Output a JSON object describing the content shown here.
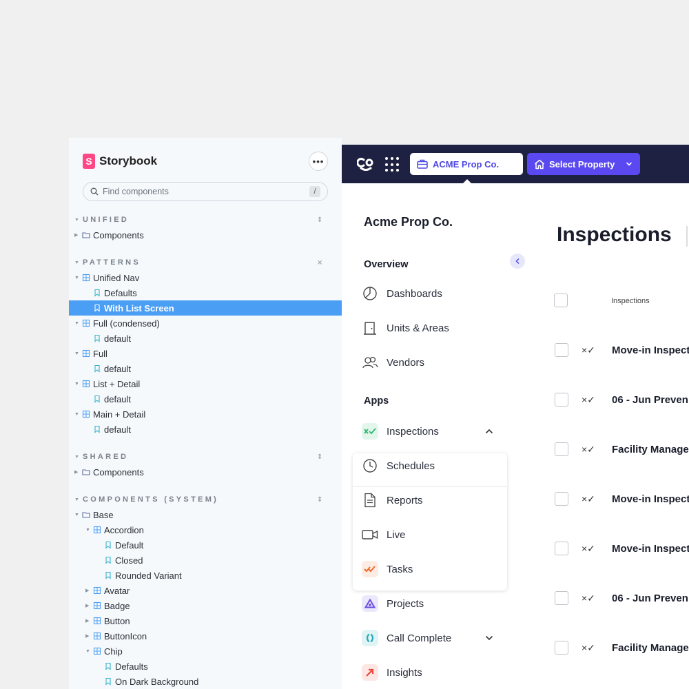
{
  "storybook": {
    "title": "Storybook",
    "logo_letter": "S",
    "search_placeholder": "Find components",
    "search_shortcut": "/",
    "groups": [
      {
        "label": "UNIFIED",
        "items": [
          {
            "type": "folder",
            "label": "Components",
            "level": 0
          }
        ]
      },
      {
        "label": "PATTERNS",
        "items": [
          {
            "type": "component",
            "label": "Unified Nav",
            "level": 0,
            "open": true
          },
          {
            "type": "story",
            "label": "Defaults",
            "level": 1
          },
          {
            "type": "story",
            "label": "With List Screen",
            "level": 1,
            "selected": true
          },
          {
            "type": "component",
            "label": "Full (condensed)",
            "level": 0,
            "open": true
          },
          {
            "type": "story",
            "label": "default",
            "level": 1
          },
          {
            "type": "component",
            "label": "Full",
            "level": 0,
            "open": true
          },
          {
            "type": "story",
            "label": "default",
            "level": 1
          },
          {
            "type": "component",
            "label": "List + Detail",
            "level": 0,
            "open": true
          },
          {
            "type": "story",
            "label": "default",
            "level": 1
          },
          {
            "type": "component",
            "label": "Main + Detail",
            "level": 0,
            "open": true
          },
          {
            "type": "story",
            "label": "default",
            "level": 1
          }
        ]
      },
      {
        "label": "SHARED",
        "items": [
          {
            "type": "folder",
            "label": "Components",
            "level": 0
          }
        ]
      },
      {
        "label": "COMPONENTS (SYSTEM)",
        "items": [
          {
            "type": "folder",
            "label": "Base",
            "level": 0,
            "open": true
          },
          {
            "type": "component",
            "label": "Accordion",
            "level": 1,
            "open": true
          },
          {
            "type": "story",
            "label": "Default",
            "level": 2
          },
          {
            "type": "story",
            "label": "Closed",
            "level": 2
          },
          {
            "type": "story",
            "label": "Rounded Variant",
            "level": 2
          },
          {
            "type": "component",
            "label": "Avatar",
            "level": 1
          },
          {
            "type": "component",
            "label": "Badge",
            "level": 1
          },
          {
            "type": "component",
            "label": "Button",
            "level": 1
          },
          {
            "type": "component",
            "label": "ButtonIcon",
            "level": 1
          },
          {
            "type": "component",
            "label": "Chip",
            "level": 1,
            "open": true
          },
          {
            "type": "story",
            "label": "Defaults",
            "level": 2
          },
          {
            "type": "story",
            "label": "On Dark Background",
            "level": 2
          }
        ]
      }
    ]
  },
  "app": {
    "topbar": {
      "logo": "co",
      "org_button": "ACME Prop Co.",
      "property_button": "Select Property"
    },
    "nav": {
      "org_name": "Acme Prop Co.",
      "overview_label": "Overview",
      "overview_items": [
        {
          "label": "Dashboards",
          "icon": "pie-chart-icon"
        },
        {
          "label": "Units & Areas",
          "icon": "door-icon"
        },
        {
          "label": "Vendors",
          "icon": "users-icon"
        }
      ],
      "apps_label": "Apps",
      "apps_items": [
        {
          "label": "Inspections",
          "icon": "inspections-icon",
          "color": "#2fb673",
          "bg": "#e3f6ec",
          "expanded": true
        },
        {
          "label": "Schedules",
          "icon": "clock-icon",
          "child": true
        },
        {
          "label": "Reports",
          "icon": "document-icon",
          "child": true
        },
        {
          "label": "Live",
          "icon": "video-icon",
          "child": true
        },
        {
          "label": "Tasks",
          "icon": "tasks-icon",
          "color": "#f06a2b",
          "bg": "#fdece3"
        },
        {
          "label": "Projects",
          "icon": "projects-icon",
          "color": "#6a4ce0",
          "bg": "#ece8fb"
        },
        {
          "label": "Call Complete",
          "icon": "call-complete-icon",
          "color": "#27a9b5",
          "bg": "#e0f4f6",
          "has_chevron": true
        },
        {
          "label": "Insights",
          "icon": "insights-icon",
          "color": "#e84a3b",
          "bg": "#fde6e3"
        }
      ]
    },
    "main": {
      "title": "Inspections",
      "column_header": "Inspections",
      "row_status_icon": "×✓",
      "rows": [
        "Move-in Inspect",
        "06 - Jun Preven",
        "Facility Manage",
        "Move-in Inspect",
        "Move-in Inspect",
        "06 - Jun Preven",
        "Facility Manage"
      ]
    }
  },
  "colors": {
    "storybook_bg": "#f6f9fc",
    "selected_row": "#4a9ef4",
    "topbar": "#1e2142",
    "primary": "#5a49f0"
  }
}
